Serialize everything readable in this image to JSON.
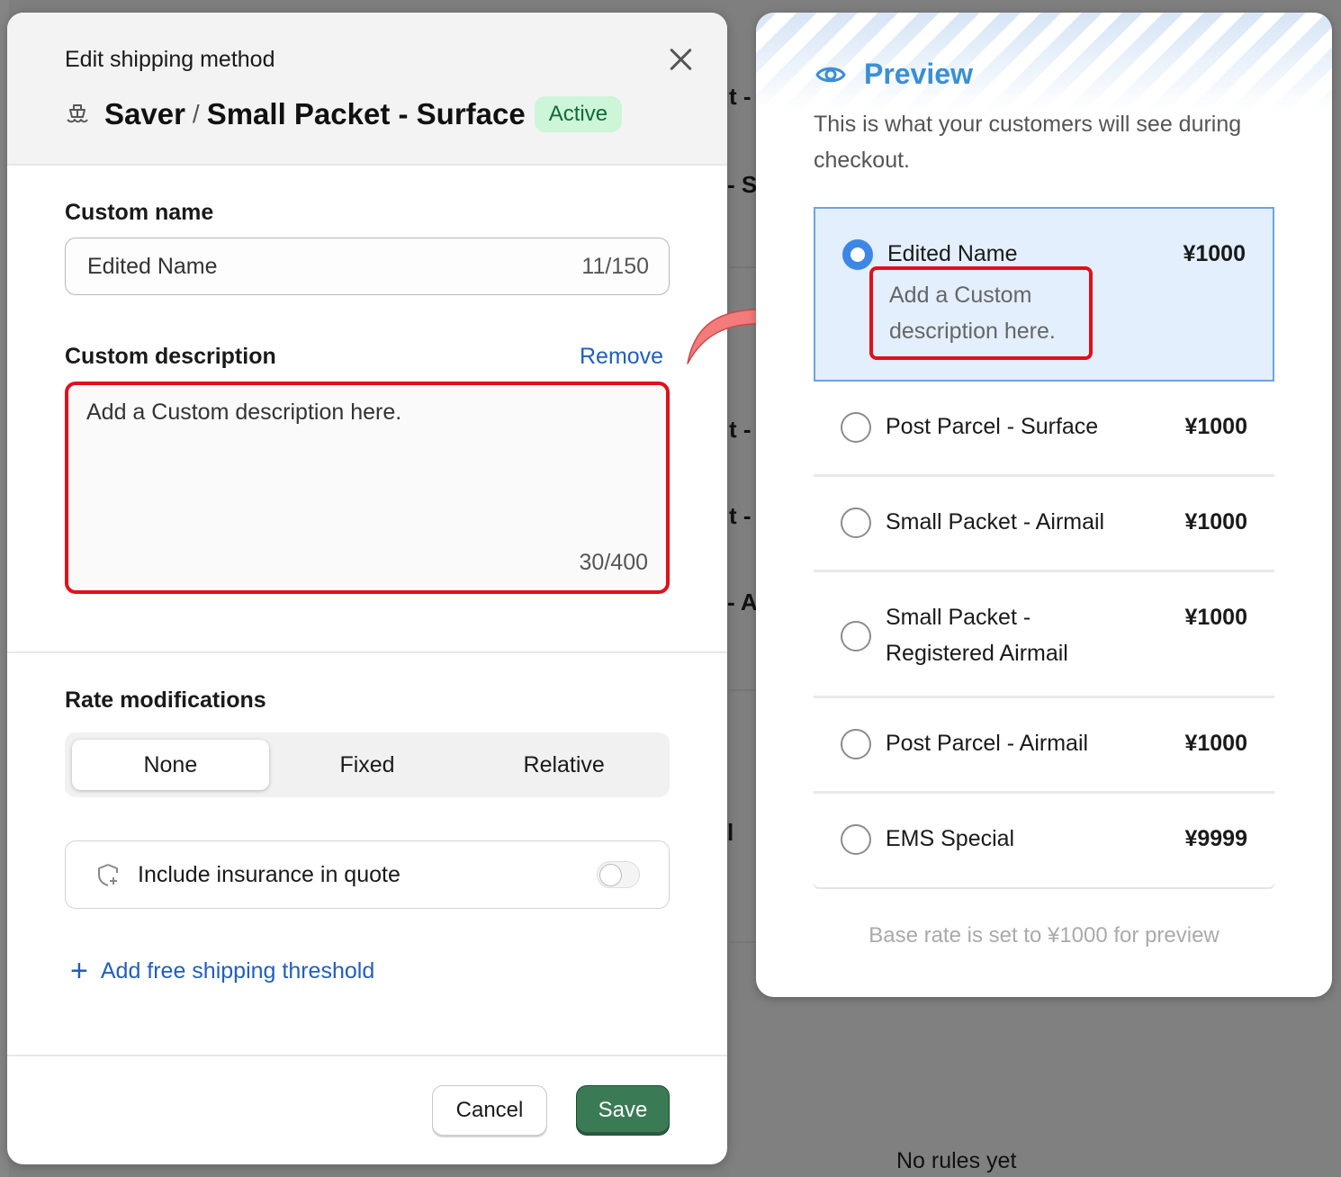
{
  "background": {
    "fragments": [
      "t -",
      "- S",
      "t -",
      "t -",
      "- A",
      "l"
    ],
    "no_rules": "No rules yet"
  },
  "modal": {
    "kicker": "Edit shipping method",
    "title_part1": "Saver",
    "title_sep": "/",
    "title_part2": "Small Packet - Surface",
    "status_badge": "Active",
    "custom_name": {
      "label": "Custom name",
      "value": "Edited Name",
      "counter": "11/150"
    },
    "custom_description": {
      "label": "Custom description",
      "remove_label": "Remove",
      "value": "Add a Custom description here.",
      "counter": "30/400"
    },
    "rate_modifications": {
      "label": "Rate modifications",
      "options": [
        "None",
        "Fixed",
        "Relative"
      ],
      "selected": "None"
    },
    "insurance": {
      "label": "Include insurance in quote",
      "enabled": false
    },
    "add_threshold_label": "Add free shipping threshold",
    "cancel_label": "Cancel",
    "save_label": "Save"
  },
  "preview": {
    "title": "Preview",
    "subtitle": "This is what your customers will see during checkout.",
    "options": [
      {
        "name": "Edited Name",
        "price": "¥1000",
        "description": "Add a Custom description here.",
        "selected": true
      },
      {
        "name": "Post Parcel - Surface",
        "price": "¥1000",
        "selected": false
      },
      {
        "name": "Small Packet - Airmail",
        "price": "¥1000",
        "selected": false
      },
      {
        "name": "Small Packet - Registered Airmail",
        "price": "¥1000",
        "selected": false
      },
      {
        "name": "Post Parcel - Airmail",
        "price": "¥1000",
        "selected": false
      },
      {
        "name": "EMS Special",
        "price": "¥9999",
        "selected": false
      }
    ],
    "footer": "Base rate is set to ¥1000 for preview"
  },
  "colors": {
    "accent_blue": "#3a8fd6",
    "link_blue": "#1f5fbf",
    "save_green": "#3a7a55",
    "highlight_red": "#e0101b",
    "badge_green": "#cdf5d8"
  }
}
